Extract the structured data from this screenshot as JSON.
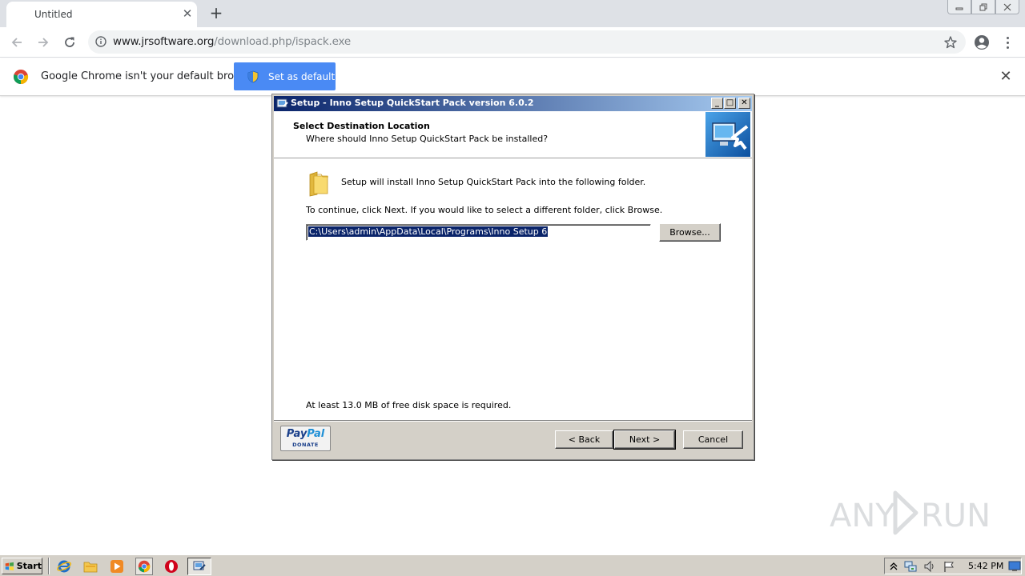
{
  "browser": {
    "tab_title": "Untitled",
    "url_host": "www.jrsoftware.org",
    "url_path": "/download.php/ispack.exe"
  },
  "infobar": {
    "message": "Google Chrome isn't your default browser",
    "set_default_label": "Set as default"
  },
  "dialog": {
    "title": "Setup - Inno Setup QuickStart Pack version 6.0.2",
    "heading": "Select Destination Location",
    "subheading": "Where should Inno Setup QuickStart Pack be installed?",
    "install_message": "Setup will install Inno Setup QuickStart Pack into the following folder.",
    "continue_message": "To continue, click Next. If you would like to select a different folder, click Browse.",
    "install_path": "C:\\Users\\admin\\AppData\\Local\\Programs\\Inno Setup 6",
    "browse_label": "Browse...",
    "disk_space_message": "At least 13.0 MB of free disk space is required.",
    "back_label": "< Back",
    "next_label": "Next >",
    "cancel_label": "Cancel",
    "paypal_pay": "Pay",
    "paypal_pal": "Pal",
    "paypal_donate": "DONATE"
  },
  "taskbar": {
    "start_label": "Start",
    "clock": "5:42 PM"
  },
  "watermark": {
    "text_left": "ANY",
    "text_right": "RUN"
  },
  "colors": {
    "chrome_tabstrip": "#dee1e6",
    "set_default_button": "#4a8af4",
    "dialog_face": "#d4d0c8",
    "titlebar_start": "#0a246a",
    "titlebar_end": "#a6caf0"
  },
  "icons": {
    "back": "arrow-left-icon",
    "forward": "arrow-right-icon",
    "reload": "reload-icon",
    "info": "info-icon",
    "bookmark": "star-icon",
    "profile": "account-icon",
    "menu": "kebab-icon"
  }
}
